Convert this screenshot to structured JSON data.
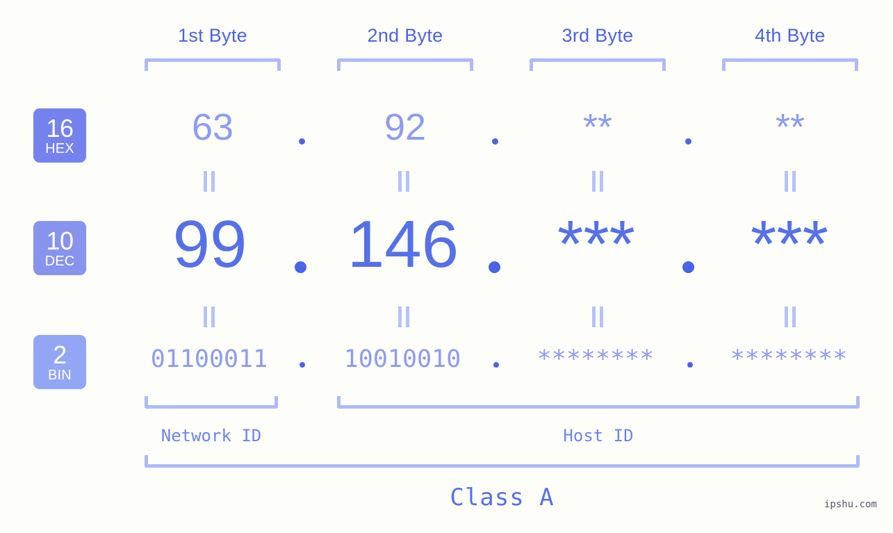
{
  "page": {
    "background": "#fdfefa",
    "credit": "ipshu.com"
  },
  "colors": {
    "bracket": "#aebaf8",
    "header_text": "#4a63e7",
    "hex_text": "#8d9bf0",
    "dec_text": "#5570e8",
    "bin_text": "#8d9bf0",
    "badge_hex": "#7582ed",
    "badge_dec": "#8793ed",
    "badge_bin": "#93a5f5",
    "dot": "#4a63e7",
    "equals": "#b6c2f8",
    "id_label": "#6b84ef",
    "class_label": "#5570e8"
  },
  "headers": [
    {
      "label": "1st Byte"
    },
    {
      "label": "2nd Byte"
    },
    {
      "label": "3rd Byte"
    },
    {
      "label": "4th Byte"
    }
  ],
  "bases": [
    {
      "num": "16",
      "name": "HEX"
    },
    {
      "num": "10",
      "name": "DEC"
    },
    {
      "num": "2",
      "name": "BIN"
    }
  ],
  "rows": {
    "hex": {
      "values": [
        "63",
        "92",
        "**",
        "**"
      ],
      "separator": "."
    },
    "dec": {
      "values": [
        "99",
        "146",
        "***",
        "***"
      ],
      "separator": "."
    },
    "bin": {
      "values": [
        "01100011",
        "10010010",
        "********",
        "********"
      ],
      "separator": "."
    }
  },
  "equals_symbol": "=",
  "ranges": {
    "network_id": "Network ID",
    "host_id": "Host ID",
    "class": "Class A"
  }
}
